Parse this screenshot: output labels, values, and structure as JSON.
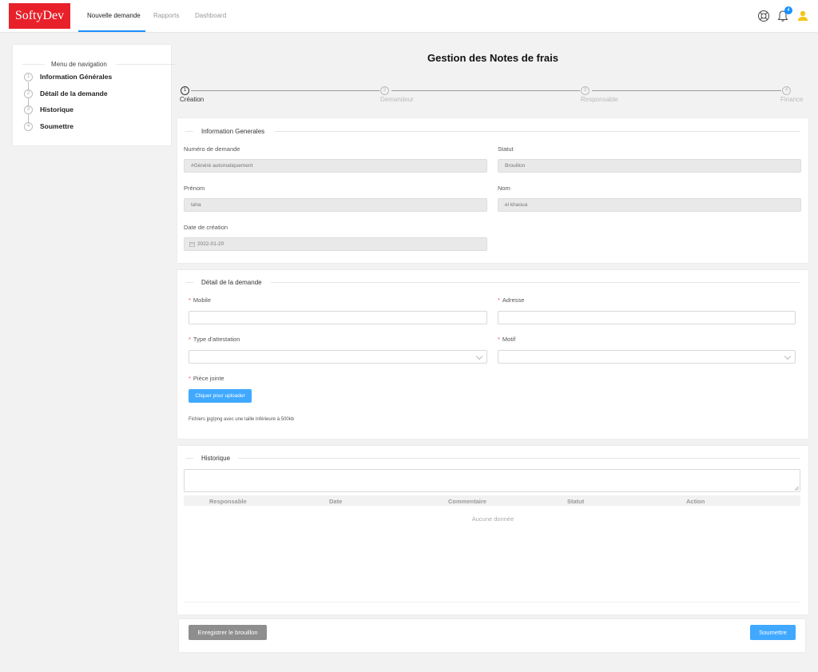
{
  "header": {
    "logo": "SoftyDev",
    "tabs": [
      {
        "label": "Nouvelle demande",
        "active": true
      },
      {
        "label": "Rapports",
        "active": false
      },
      {
        "label": "Dashboard",
        "active": false
      }
    ],
    "notification_count": "4",
    "accent": "#1890ff",
    "brand_color": "#e8202a"
  },
  "sidebar": {
    "title": "Menu de navigation",
    "items": [
      {
        "num": "1",
        "label": "Information Générales"
      },
      {
        "num": "2",
        "label": "Détail de la demande"
      },
      {
        "num": "3",
        "label": "Historique"
      },
      {
        "num": "4",
        "label": "Soumettre"
      }
    ]
  },
  "page_title": "Gestion des Notes de frais",
  "stepper": [
    {
      "num": "1",
      "label": "Création"
    },
    {
      "num": "2",
      "label": "Demandeur"
    },
    {
      "num": "3",
      "label": "Responsable"
    },
    {
      "num": "4",
      "label": "Finance"
    }
  ],
  "info": {
    "legend": "Information Generales",
    "numero_label": "Numéro de demande",
    "numero_value": "#Généré automatiquement",
    "statut_label": "Statut",
    "statut_value": "Brouillon",
    "prenom_label": "Prénom",
    "prenom_value": "taha",
    "nom_label": "Nom",
    "nom_value": "el khaoua",
    "date_label": "Date de création",
    "date_value": "2022-01-20"
  },
  "detail": {
    "legend": "Détail de la demande",
    "mobile_label": "Mobile",
    "adresse_label": "Adresse",
    "type_label": "Type d'attestation",
    "motif_label": "Motif",
    "piece_label": "Pièce jointe",
    "upload_button": "Cliquer pour uploader",
    "hint": "Fichiers jpg/png avec une taille inférieure à 500kb"
  },
  "historique": {
    "legend": "Historique",
    "columns": [
      "Responsable",
      "Date",
      "Commentaire",
      "Statut",
      "Action"
    ],
    "empty": "Aucune donnée"
  },
  "footer": {
    "save_label": "Enregistrer le brouillon",
    "submit_label": "Soumettre"
  }
}
